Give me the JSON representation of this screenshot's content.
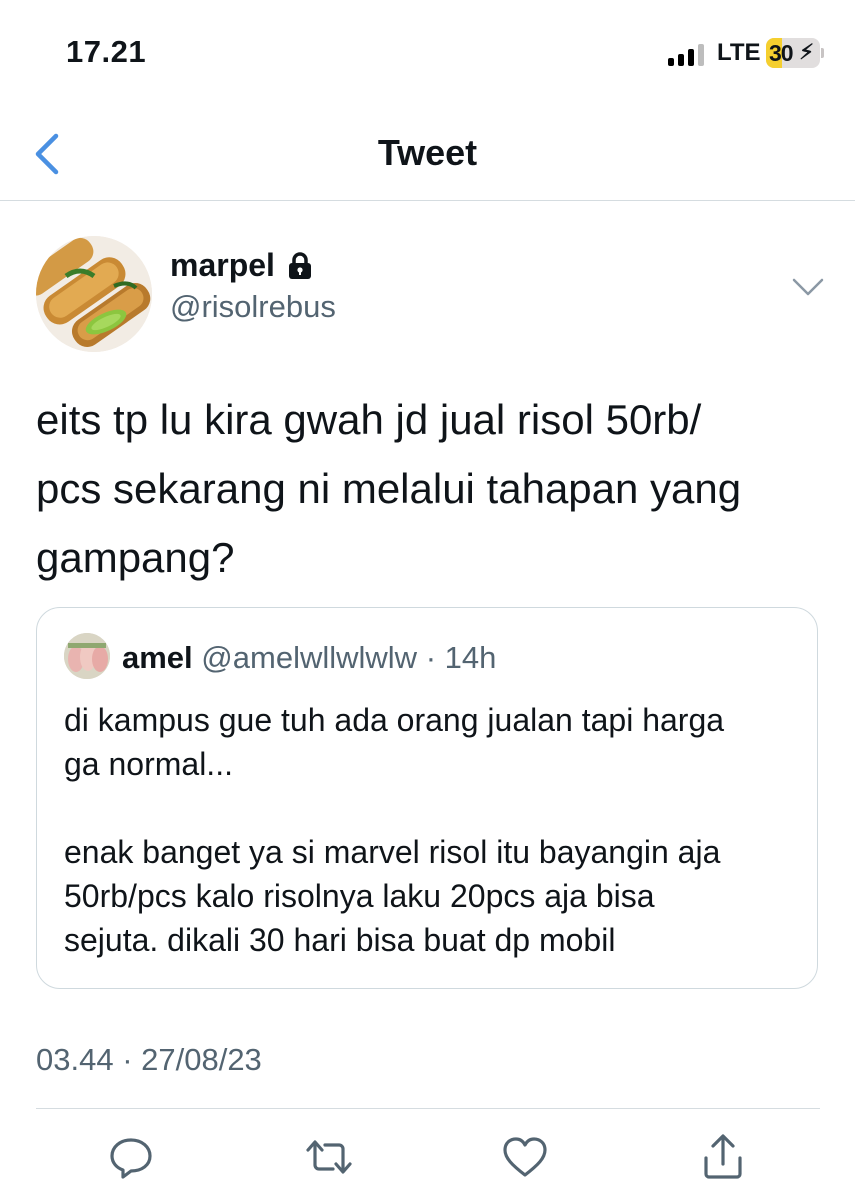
{
  "status_bar": {
    "time": "17.21",
    "network": "LTE",
    "battery": "30",
    "battery_level": 0.3,
    "colors": {
      "battery_fill": "#f5cf2f"
    }
  },
  "header": {
    "title": "Tweet",
    "back_icon": "chevron-left-icon",
    "colors": {
      "accent": "#4a90e2"
    }
  },
  "tweet": {
    "author": {
      "name": "marpel",
      "handle": "@risolrebus",
      "protected_icon": "lock-icon"
    },
    "text": "eits tp lu kira gwah jd jual risol 50rb/\npcs sekarang ni melalui tahapan yang\ngampang?",
    "timestamp": "03.44 · 27/08/23"
  },
  "quote": {
    "name": "amel",
    "handle": "@amelwllwlwlw",
    "separator": "·",
    "age": "14h",
    "text": "di kampus gue tuh ada orang jualan tapi harga\nga normal...\n\nenak banget ya si marvel risol itu bayangin aja\n50rb/pcs kalo risolnya laku 20pcs aja bisa\nsejuta. dikali 30 hari bisa buat dp mobil"
  },
  "actions": [
    "reply-icon",
    "retweet-icon",
    "like-icon",
    "share-icon"
  ],
  "colors": {
    "secondary_text": "#536471",
    "divider": "#d5dce0",
    "icon": "#536471"
  }
}
